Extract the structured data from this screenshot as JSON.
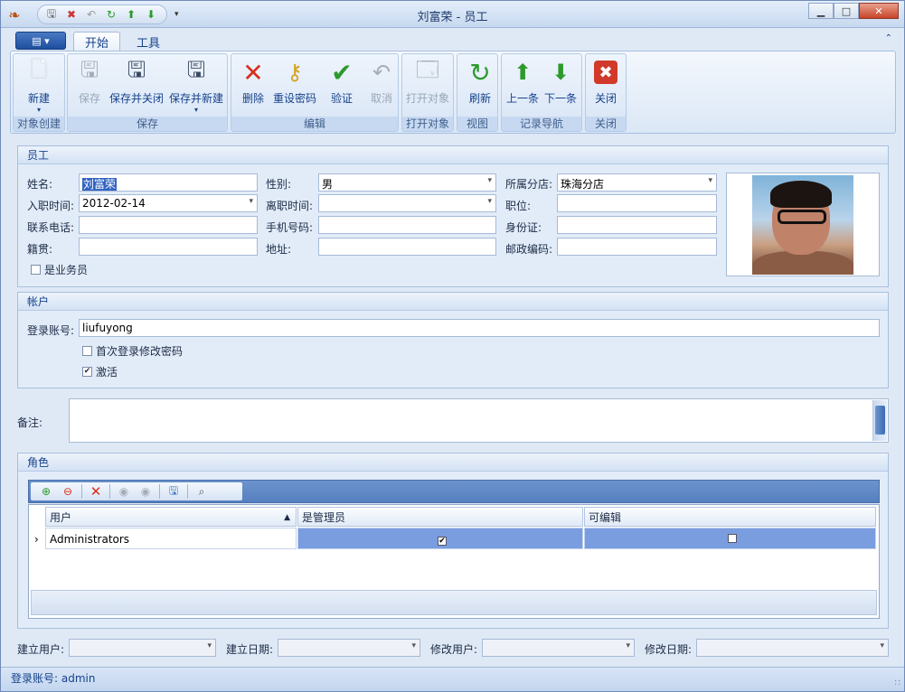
{
  "window": {
    "title": "刘富荣 - 员工"
  },
  "ribbon": {
    "tabs": [
      {
        "label": "开始",
        "active": true
      },
      {
        "label": "工具",
        "active": false
      }
    ],
    "groups": [
      {
        "label": "对象创建",
        "buttons": [
          {
            "label": "新建",
            "icon": "new-document-icon",
            "dropdown": true
          }
        ]
      },
      {
        "label": "保存",
        "buttons": [
          {
            "label": "保存",
            "icon": "save-icon",
            "disabled": true
          },
          {
            "label": "保存并关闭",
            "icon": "save-close-icon"
          },
          {
            "label": "保存并新建",
            "icon": "save-new-icon",
            "dropdown": true
          }
        ]
      },
      {
        "label": "编辑",
        "buttons": [
          {
            "label": "删除",
            "icon": "delete-icon"
          },
          {
            "label": "重设密码",
            "icon": "key-icon"
          },
          {
            "label": "验证",
            "icon": "check-icon"
          },
          {
            "label": "取消",
            "icon": "undo-icon",
            "disabled": true
          }
        ]
      },
      {
        "label": "打开对象",
        "buttons": [
          {
            "label": "打开对象",
            "icon": "open-object-icon",
            "disabled": true
          }
        ]
      },
      {
        "label": "视图",
        "buttons": [
          {
            "label": "刷新",
            "icon": "refresh-icon"
          }
        ]
      },
      {
        "label": "记录导航",
        "buttons": [
          {
            "label": "上一条",
            "icon": "arrow-up-icon"
          },
          {
            "label": "下一条",
            "icon": "arrow-down-icon"
          }
        ]
      },
      {
        "label": "关闭",
        "buttons": [
          {
            "label": "关闭",
            "icon": "close-icon"
          }
        ]
      }
    ]
  },
  "employee": {
    "section_title": "员工",
    "name_label": "姓名:",
    "name_value": "刘富荣",
    "gender_label": "性别:",
    "gender_value": "男",
    "branch_label": "所属分店:",
    "branch_value": "珠海分店",
    "hire_label": "入职时间:",
    "hire_value": "2012-02-14",
    "leave_label": "离职时间:",
    "leave_value": "",
    "position_label": "职位:",
    "position_value": "",
    "phone_label": "联系电话:",
    "phone_value": "",
    "mobile_label": "手机号码:",
    "mobile_value": "",
    "idcard_label": "身份证:",
    "idcard_value": "",
    "origin_label": "籍贯:",
    "origin_value": "",
    "address_label": "地址:",
    "address_value": "",
    "postcode_label": "邮政编码:",
    "postcode_value": "",
    "salesman_label": "是业务员",
    "salesman_checked": false
  },
  "account": {
    "section_title": "帐户",
    "login_label": "登录账号:",
    "login_value": "liufuyong",
    "change_pwd_label": "首次登录修改密码",
    "change_pwd_checked": false,
    "active_label": "激活",
    "active_checked": true
  },
  "notes": {
    "label": "备注:",
    "value": ""
  },
  "roles": {
    "section_title": "角色",
    "columns": [
      "用户",
      "是管理员",
      "可编辑"
    ],
    "rows": [
      {
        "user": "Administrators",
        "is_admin": true,
        "editable": false
      }
    ]
  },
  "meta": {
    "created_by_label": "建立用户:",
    "created_date_label": "建立日期:",
    "modified_by_label": "修改用户:",
    "modified_date_label": "修改日期:"
  },
  "status": {
    "text": "登录账号: admin"
  }
}
